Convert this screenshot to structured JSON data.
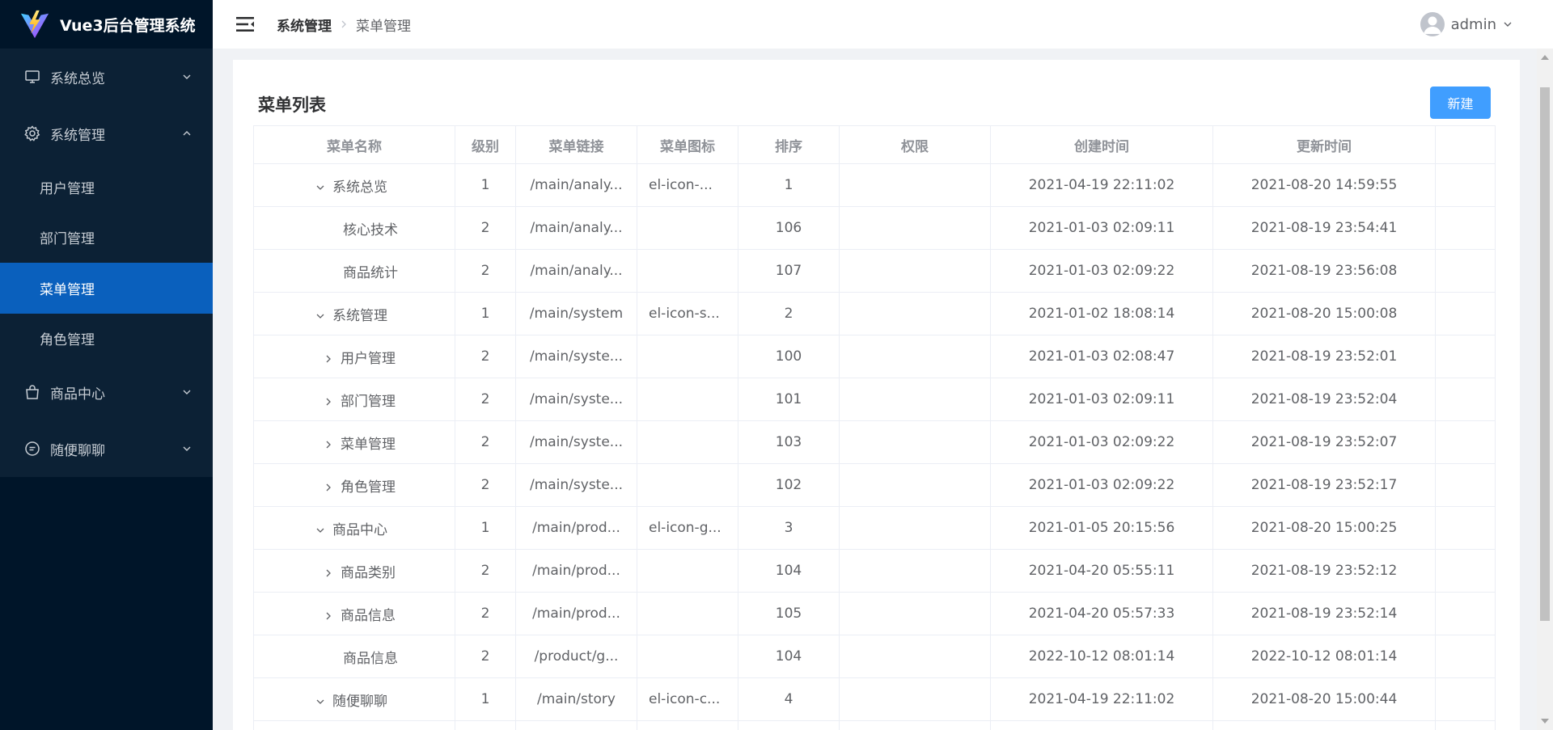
{
  "app": {
    "title": "Vue3后台管理系统"
  },
  "sidebar": {
    "groups": [
      {
        "label": "系统总览",
        "icon": "monitor-icon",
        "expanded": false
      },
      {
        "label": "系统管理",
        "icon": "gear-icon",
        "expanded": true,
        "items": [
          {
            "label": "用户管理",
            "active": false
          },
          {
            "label": "部门管理",
            "active": false
          },
          {
            "label": "菜单管理",
            "active": true
          },
          {
            "label": "角色管理",
            "active": false
          }
        ]
      },
      {
        "label": "商品中心",
        "icon": "shopping-bag-icon",
        "expanded": false
      },
      {
        "label": "随便聊聊",
        "icon": "chat-icon",
        "expanded": false
      }
    ]
  },
  "header": {
    "breadcrumb": [
      "系统管理",
      "菜单管理"
    ],
    "username": "admin"
  },
  "main": {
    "title": "菜单列表",
    "new_button": "新建",
    "columns": [
      "菜单名称",
      "级别",
      "菜单链接",
      "菜单图标",
      "排序",
      "权限",
      "创建时间",
      "更新时间",
      ""
    ],
    "rows": [
      {
        "name": "系统总览",
        "level": "1",
        "url": "/main/analy...",
        "icon": "el-icon-...",
        "sort": "1",
        "permission": "",
        "created": "2021-04-19 22:11:02",
        "updated": "2021-08-20 14:59:55"
      },
      {
        "name": "核心技术",
        "level": "2",
        "url": "/main/analy...",
        "icon": "",
        "sort": "106",
        "permission": "",
        "created": "2021-01-03 02:09:11",
        "updated": "2021-08-19 23:54:41"
      },
      {
        "name": "商品统计",
        "level": "2",
        "url": "/main/analy...",
        "icon": "",
        "sort": "107",
        "permission": "",
        "created": "2021-01-03 02:09:22",
        "updated": "2021-08-19 23:56:08"
      },
      {
        "name": "系统管理",
        "level": "1",
        "url": "/main/system",
        "icon": "el-icon-s...",
        "sort": "2",
        "permission": "",
        "created": "2021-01-02 18:08:14",
        "updated": "2021-08-20 15:00:08"
      },
      {
        "name": "用户管理",
        "level": "2",
        "url": "/main/syste...",
        "icon": "",
        "sort": "100",
        "permission": "",
        "created": "2021-01-03 02:08:47",
        "updated": "2021-08-19 23:52:01"
      },
      {
        "name": "部门管理",
        "level": "2",
        "url": "/main/syste...",
        "icon": "",
        "sort": "101",
        "permission": "",
        "created": "2021-01-03 02:09:11",
        "updated": "2021-08-19 23:52:04"
      },
      {
        "name": "菜单管理",
        "level": "2",
        "url": "/main/syste...",
        "icon": "",
        "sort": "103",
        "permission": "",
        "created": "2021-01-03 02:09:22",
        "updated": "2021-08-19 23:52:07"
      },
      {
        "name": "角色管理",
        "level": "2",
        "url": "/main/syste...",
        "icon": "",
        "sort": "102",
        "permission": "",
        "created": "2021-01-03 02:09:22",
        "updated": "2021-08-19 23:52:17"
      },
      {
        "name": "商品中心",
        "level": "1",
        "url": "/main/prod...",
        "icon": "el-icon-g...",
        "sort": "3",
        "permission": "",
        "created": "2021-01-05 20:15:56",
        "updated": "2021-08-20 15:00:25"
      },
      {
        "name": "商品类别",
        "level": "2",
        "url": "/main/prod...",
        "icon": "",
        "sort": "104",
        "permission": "",
        "created": "2021-04-20 05:55:11",
        "updated": "2021-08-19 23:52:12"
      },
      {
        "name": "商品信息",
        "level": "2",
        "url": "/main/prod...",
        "icon": "",
        "sort": "105",
        "permission": "",
        "created": "2021-04-20 05:57:33",
        "updated": "2021-08-19 23:52:14"
      },
      {
        "name": "商品信息",
        "level": "2",
        "url": "/product/g...",
        "icon": "",
        "sort": "104",
        "permission": "",
        "created": "2022-10-12 08:01:14",
        "updated": "2022-10-12 08:01:14"
      },
      {
        "name": "随便聊聊",
        "level": "1",
        "url": "/main/story",
        "icon": "el-icon-c...",
        "sort": "4",
        "permission": "",
        "created": "2021-04-19 22:11:02",
        "updated": "2021-08-20 15:00:44"
      },
      {
        "name": "",
        "level": "",
        "url": "",
        "icon": "",
        "sort": "",
        "permission": "",
        "created": "",
        "updated": ""
      }
    ]
  }
}
